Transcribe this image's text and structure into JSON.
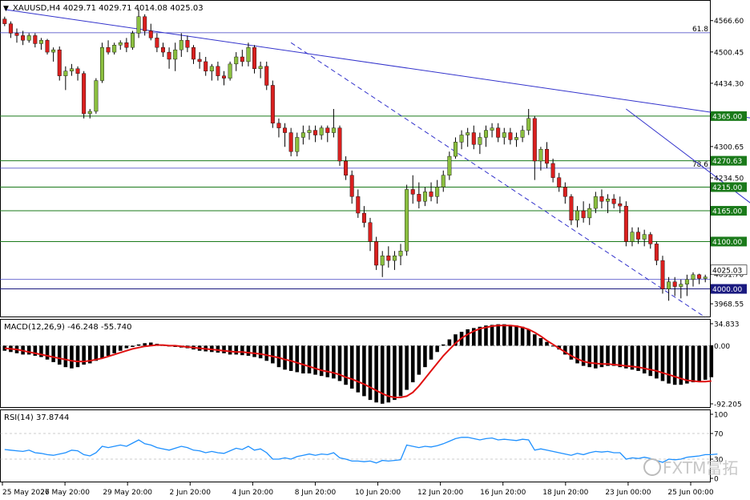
{
  "symbol_header": "XAUUSD,H4  4029.71 4029.71 4014.08 4025.03",
  "colors": {
    "background": "#ffffff",
    "candle_up": "#8bbf3f",
    "candle_down": "#d9201f",
    "wick": "#000000",
    "level_line": "#1a7a1a",
    "fib_line": "#3b3bc0",
    "trend_line": "#3333cc",
    "macd_hist": "#000000",
    "macd_signal": "#e01010",
    "rsi_line": "#1e90ff",
    "label_box": "#1a7a1a",
    "current_price_box": "#1a1a80",
    "border": "#000000"
  },
  "price_axis": {
    "ticks": [
      "4566.60",
      "4500.45",
      "4434.30",
      "4300.65",
      "4234.50",
      "4031.70",
      "3968.55"
    ],
    "level_labels": [
      {
        "text": "4365.00",
        "value": 4365.0
      },
      {
        "text": "4270.63",
        "value": 4270.63
      },
      {
        "text": "4215.00",
        "value": 4215.0
      },
      {
        "text": "4165.00",
        "value": 4165.0
      },
      {
        "text": "4100.00",
        "value": 4100.0
      },
      {
        "text": "4000.00",
        "value": 4000.0
      }
    ],
    "current_price": "4025.03",
    "fib_labels": [
      {
        "text": "61.8",
        "value": 4541.0
      },
      {
        "text": "78.6",
        "value": 4255.0
      }
    ]
  },
  "macd": {
    "label": "MACD(12,26,9) -46.248 -55.740",
    "ticks": [
      "34.833",
      "0.00",
      "-92.205"
    ]
  },
  "rsi": {
    "label": "RSI(14) 37.8744",
    "ticks": [
      "100",
      "70",
      "30",
      "0"
    ]
  },
  "time_axis": [
    "25 May 2026",
    "27 May 20:00",
    "29 May 20:00",
    "2 Jun 20:00",
    "4 Jun 20:00",
    "8 Jun 20:00",
    "10 Jun 20:00",
    "12 Jun 20:00",
    "16 Jun 20:00",
    "18 Jun 20:00",
    "23 Jun 00:00",
    "25 Jun 00:00"
  ],
  "watermark": "FXTM富拓",
  "chart_data": {
    "type": "candlestick",
    "title": "XAUUSD,H4",
    "ylim": [
      3940,
      4600
    ],
    "horizontal_levels": [
      4365.0,
      4270.63,
      4215.0,
      4165.0,
      4100.0,
      4000.0
    ],
    "fib_levels": [
      {
        "label": "61.8",
        "value": 4541.0
      },
      {
        "label": "78.6",
        "value": 4255.0
      },
      {
        "label": "",
        "value": 4020.0
      }
    ],
    "trendlines": [
      {
        "style": "solid",
        "from": [
          0,
          4590
        ],
        "to": [
          139,
          4330
        ]
      },
      {
        "style": "dashed",
        "from": [
          47,
          4520
        ],
        "to": [
          115,
          3940
        ]
      },
      {
        "style": "solid",
        "from": [
          102,
          4380
        ],
        "to": [
          139,
          4020
        ]
      }
    ],
    "ohlc": [
      [
        4570,
        4575,
        4555,
        4560
      ],
      [
        4560,
        4565,
        4530,
        4540
      ],
      [
        4540,
        4550,
        4520,
        4535
      ],
      [
        4535,
        4545,
        4515,
        4525
      ],
      [
        4525,
        4540,
        4520,
        4535
      ],
      [
        4535,
        4540,
        4510,
        4518
      ],
      [
        4518,
        4530,
        4505,
        4525
      ],
      [
        4525,
        4528,
        4495,
        4500
      ],
      [
        4500,
        4510,
        4480,
        4505
      ],
      [
        4505,
        4512,
        4440,
        4450
      ],
      [
        4450,
        4470,
        4420,
        4460
      ],
      [
        4460,
        4475,
        4450,
        4465
      ],
      [
        4465,
        4470,
        4440,
        4455
      ],
      [
        4455,
        4460,
        4360,
        4370
      ],
      [
        4370,
        4380,
        4360,
        4375
      ],
      [
        4375,
        4445,
        4370,
        4440
      ],
      [
        4440,
        4520,
        4435,
        4510
      ],
      [
        4510,
        4525,
        4495,
        4500
      ],
      [
        4500,
        4520,
        4495,
        4515
      ],
      [
        4515,
        4525,
        4505,
        4520
      ],
      [
        4520,
        4530,
        4500,
        4510
      ],
      [
        4510,
        4545,
        4505,
        4540
      ],
      [
        4540,
        4590,
        4530,
        4575
      ],
      [
        4575,
        4580,
        4535,
        4545
      ],
      [
        4545,
        4560,
        4525,
        4530
      ],
      [
        4530,
        4540,
        4500,
        4510
      ],
      [
        4510,
        4520,
        4490,
        4500
      ],
      [
        4500,
        4510,
        4465,
        4485
      ],
      [
        4485,
        4520,
        4460,
        4505
      ],
      [
        4505,
        4540,
        4490,
        4525
      ],
      [
        4525,
        4535,
        4500,
        4510
      ],
      [
        4510,
        4515,
        4475,
        4485
      ],
      [
        4485,
        4500,
        4465,
        4480
      ],
      [
        4480,
        4490,
        4450,
        4460
      ],
      [
        4460,
        4475,
        4440,
        4470
      ],
      [
        4470,
        4480,
        4440,
        4450
      ],
      [
        4450,
        4460,
        4430,
        4445
      ],
      [
        4445,
        4480,
        4440,
        4475
      ],
      [
        4475,
        4500,
        4460,
        4490
      ],
      [
        4490,
        4505,
        4470,
        4480
      ],
      [
        4480,
        4520,
        4470,
        4510
      ],
      [
        4510,
        4515,
        4455,
        4465
      ],
      [
        4465,
        4480,
        4445,
        4470
      ],
      [
        4470,
        4480,
        4420,
        4430
      ],
      [
        4430,
        4440,
        4340,
        4350
      ],
      [
        4350,
        4360,
        4320,
        4340
      ],
      [
        4340,
        4350,
        4300,
        4330
      ],
      [
        4330,
        4340,
        4280,
        4290
      ],
      [
        4290,
        4330,
        4280,
        4320
      ],
      [
        4320,
        4345,
        4305,
        4330
      ],
      [
        4330,
        4345,
        4315,
        4335
      ],
      [
        4335,
        4345,
        4310,
        4325
      ],
      [
        4325,
        4345,
        4315,
        4340
      ],
      [
        4340,
        4345,
        4310,
        4330
      ],
      [
        4330,
        4380,
        4320,
        4340
      ],
      [
        4340,
        4345,
        4260,
        4270
      ],
      [
        4270,
        4280,
        4230,
        4240
      ],
      [
        4240,
        4250,
        4180,
        4195
      ],
      [
        4195,
        4210,
        4150,
        4160
      ],
      [
        4160,
        4175,
        4130,
        4140
      ],
      [
        4140,
        4150,
        4080,
        4100
      ],
      [
        4100,
        4110,
        4040,
        4050
      ],
      [
        4050,
        4080,
        4025,
        4070
      ],
      [
        4070,
        4090,
        4045,
        4060
      ],
      [
        4060,
        4080,
        4040,
        4070
      ],
      [
        4070,
        4095,
        4050,
        4080
      ],
      [
        4080,
        4220,
        4070,
        4210
      ],
      [
        4210,
        4240,
        4180,
        4200
      ],
      [
        4200,
        4225,
        4170,
        4185
      ],
      [
        4185,
        4215,
        4175,
        4205
      ],
      [
        4205,
        4225,
        4185,
        4195
      ],
      [
        4195,
        4230,
        4180,
        4215
      ],
      [
        4215,
        4250,
        4205,
        4240
      ],
      [
        4240,
        4290,
        4230,
        4280
      ],
      [
        4280,
        4320,
        4275,
        4310
      ],
      [
        4310,
        4335,
        4295,
        4325
      ],
      [
        4325,
        4340,
        4300,
        4330
      ],
      [
        4330,
        4345,
        4295,
        4305
      ],
      [
        4305,
        4330,
        4285,
        4320
      ],
      [
        4320,
        4345,
        4300,
        4335
      ],
      [
        4335,
        4350,
        4320,
        4340
      ],
      [
        4340,
        4350,
        4310,
        4320
      ],
      [
        4320,
        4340,
        4305,
        4330
      ],
      [
        4330,
        4340,
        4305,
        4315
      ],
      [
        4315,
        4330,
        4300,
        4320
      ],
      [
        4320,
        4345,
        4310,
        4335
      ],
      [
        4335,
        4380,
        4325,
        4360
      ],
      [
        4360,
        4365,
        4230,
        4270
      ],
      [
        4270,
        4300,
        4250,
        4295
      ],
      [
        4295,
        4310,
        4255,
        4265
      ],
      [
        4265,
        4275,
        4225,
        4235
      ],
      [
        4235,
        4245,
        4205,
        4215
      ],
      [
        4215,
        4225,
        4180,
        4195
      ],
      [
        4195,
        4200,
        4135,
        4145
      ],
      [
        4145,
        4175,
        4130,
        4165
      ],
      [
        4165,
        4185,
        4140,
        4150
      ],
      [
        4150,
        4180,
        4135,
        4170
      ],
      [
        4170,
        4205,
        4160,
        4195
      ],
      [
        4195,
        4210,
        4170,
        4185
      ],
      [
        4185,
        4200,
        4160,
        4190
      ],
      [
        4190,
        4200,
        4170,
        4180
      ],
      [
        4180,
        4195,
        4160,
        4175
      ],
      [
        4175,
        4185,
        4090,
        4100
      ],
      [
        4100,
        4130,
        4090,
        4120
      ],
      [
        4120,
        4130,
        4095,
        4105
      ],
      [
        4105,
        4125,
        4090,
        4115
      ],
      [
        4115,
        4120,
        4085,
        4095
      ],
      [
        4095,
        4100,
        4050,
        4060
      ],
      [
        4060,
        4070,
        3990,
        4000
      ],
      [
        4000,
        4025,
        3975,
        4015
      ],
      [
        4015,
        4025,
        3985,
        4005
      ],
      [
        4005,
        4020,
        3980,
        4010
      ],
      [
        4010,
        4030,
        3985,
        4020
      ],
      [
        4020,
        4035,
        4005,
        4030
      ],
      [
        4030,
        4032,
        4010,
        4022
      ],
      [
        4022,
        4030,
        4014,
        4025
      ]
    ],
    "macd_hist": [
      -8,
      -10,
      -12,
      -14,
      -14,
      -16,
      -18,
      -22,
      -26,
      -30,
      -34,
      -36,
      -34,
      -30,
      -28,
      -24,
      -20,
      -16,
      -12,
      -8,
      -4,
      -2,
      2,
      4,
      5,
      3,
      1,
      0,
      -2,
      -3,
      -4,
      -6,
      -8,
      -9,
      -10,
      -11,
      -12,
      -14,
      -14,
      -15,
      -16,
      -18,
      -20,
      -24,
      -28,
      -34,
      -38,
      -40,
      -42,
      -44,
      -44,
      -46,
      -48,
      -50,
      -52,
      -56,
      -62,
      -68,
      -74,
      -80,
      -86,
      -90,
      -92,
      -90,
      -86,
      -80,
      -70,
      -58,
      -46,
      -34,
      -22,
      -10,
      2,
      10,
      18,
      22,
      26,
      28,
      30,
      32,
      33,
      34,
      34,
      33,
      32,
      30,
      26,
      18,
      12,
      6,
      0,
      -6,
      -14,
      -22,
      -28,
      -32,
      -34,
      -36,
      -34,
      -32,
      -32,
      -34,
      -36,
      -38,
      -40,
      -44,
      -48,
      -52,
      -56,
      -60,
      -62,
      -62,
      -60,
      -58,
      -56,
      -54,
      -50
    ],
    "macd_signal": [
      -4,
      -5,
      -6,
      -8,
      -10,
      -12,
      -14,
      -16,
      -18,
      -20,
      -22,
      -24,
      -25,
      -25,
      -24,
      -22,
      -20,
      -17,
      -14,
      -11,
      -8,
      -5,
      -3,
      -1,
      0,
      1,
      1,
      0,
      0,
      -1,
      -2,
      -3,
      -4,
      -5,
      -6,
      -7,
      -8,
      -9,
      -10,
      -10,
      -11,
      -12,
      -13,
      -15,
      -17,
      -19,
      -22,
      -24,
      -27,
      -30,
      -33,
      -36,
      -39,
      -41,
      -43,
      -46,
      -50,
      -53,
      -57,
      -61,
      -66,
      -71,
      -76,
      -80,
      -82,
      -82,
      -80,
      -74,
      -64,
      -52,
      -40,
      -28,
      -16,
      -6,
      4,
      12,
      18,
      23,
      27,
      29,
      31,
      32,
      32,
      32,
      31,
      29,
      26,
      21,
      15,
      8,
      2,
      -4,
      -10,
      -16,
      -21,
      -25,
      -27,
      -28,
      -29,
      -29,
      -30,
      -31,
      -32,
      -33,
      -34,
      -36,
      -38,
      -40,
      -43,
      -46,
      -49,
      -52,
      -55,
      -56,
      -57,
      -57,
      -56
    ],
    "rsi": [
      45,
      44,
      43,
      42,
      44,
      40,
      39,
      37,
      36,
      38,
      40,
      44,
      43,
      37,
      35,
      40,
      50,
      48,
      50,
      52,
      50,
      55,
      60,
      54,
      52,
      48,
      46,
      44,
      47,
      50,
      48,
      44,
      43,
      40,
      42,
      40,
      39,
      43,
      47,
      45,
      50,
      44,
      46,
      40,
      30,
      30,
      32,
      30,
      34,
      36,
      38,
      36,
      38,
      37,
      40,
      32,
      30,
      27,
      27,
      26,
      27,
      24,
      28,
      27,
      28,
      29,
      52,
      50,
      48,
      50,
      49,
      51,
      54,
      58,
      62,
      64,
      64,
      62,
      60,
      62,
      63,
      60,
      61,
      60,
      59,
      61,
      60,
      44,
      46,
      44,
      42,
      40,
      38,
      36,
      39,
      37,
      40,
      42,
      41,
      42,
      40,
      40,
      30,
      32,
      31,
      33,
      31,
      28,
      25,
      30,
      29,
      30,
      33,
      34,
      35,
      37,
      37,
      38
    ]
  }
}
